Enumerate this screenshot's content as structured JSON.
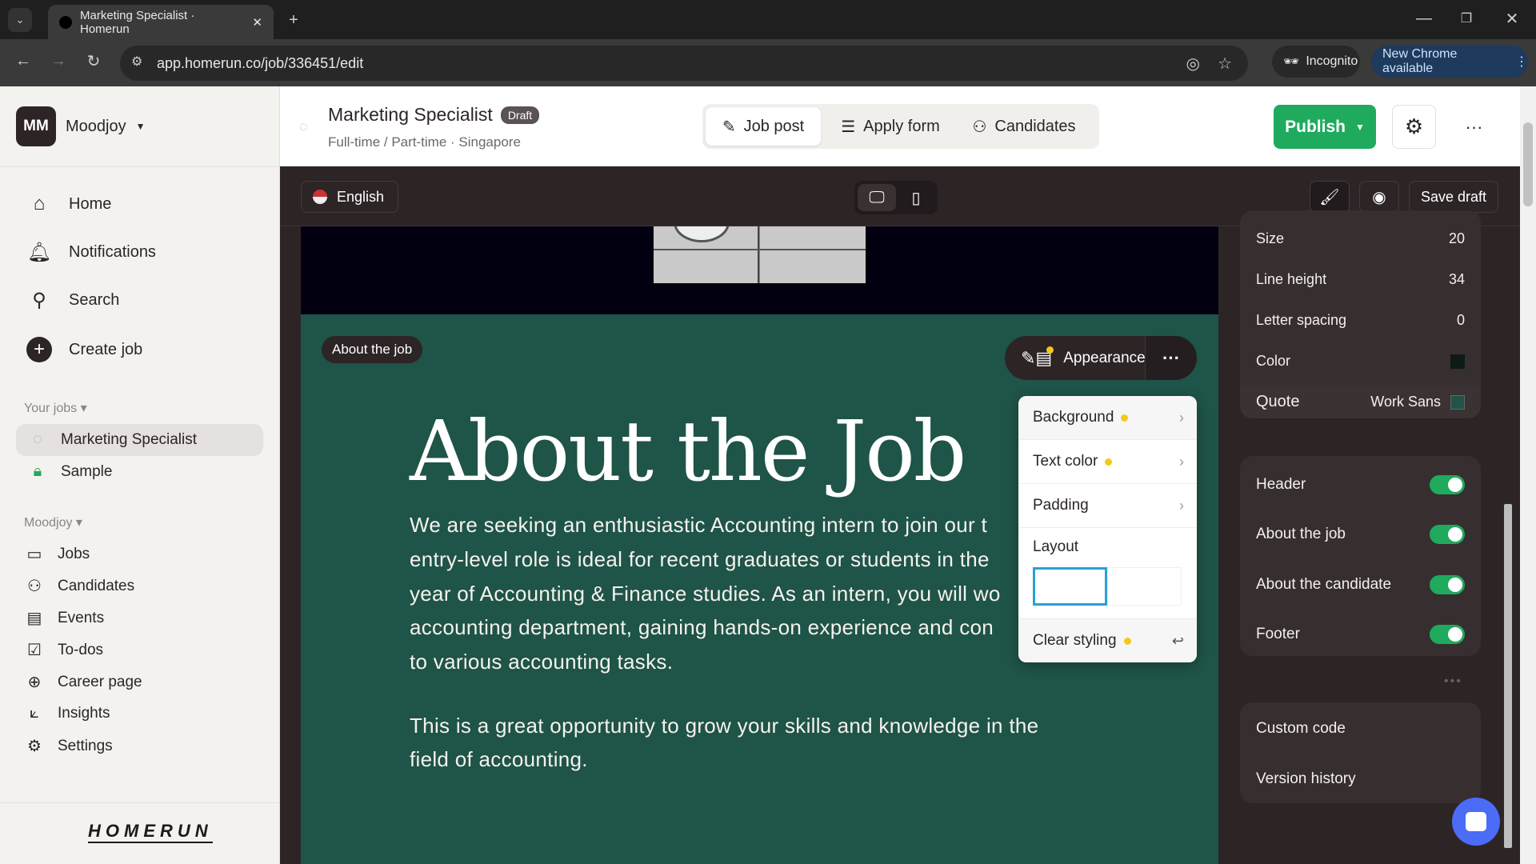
{
  "browser": {
    "tab_title": "Marketing Specialist · Homerun",
    "url": "app.homerun.co/job/336451/edit",
    "incognito": "Incognito",
    "update": "New Chrome available"
  },
  "sidebar": {
    "avatar": "MM",
    "org": "Moodjoy",
    "nav": [
      {
        "label": "Home",
        "icon": "home-icon"
      },
      {
        "label": "Notifications",
        "icon": "bell-icon"
      },
      {
        "label": "Search",
        "icon": "search-icon"
      },
      {
        "label": "Create job",
        "icon": "plus-circle-icon"
      }
    ],
    "your_jobs_label": "Your jobs",
    "jobs": [
      {
        "label": "Marketing Specialist",
        "active": true
      },
      {
        "label": "Sample"
      }
    ],
    "org_section": "Moodjoy",
    "org_items": [
      {
        "label": "Jobs",
        "icon": "jobs-icon"
      },
      {
        "label": "Candidates",
        "icon": "candidates-icon"
      },
      {
        "label": "Events",
        "icon": "calendar-icon"
      },
      {
        "label": "To-dos",
        "icon": "checkbox-icon"
      },
      {
        "label": "Career page",
        "icon": "globe-icon"
      },
      {
        "label": "Insights",
        "icon": "chart-icon"
      },
      {
        "label": "Settings",
        "icon": "gear-icon"
      }
    ],
    "logo": "HOMERUN"
  },
  "header": {
    "title": "Marketing Specialist",
    "badge": "Draft",
    "subtitle": "Full-time / Part-time · Singapore",
    "tabs": [
      {
        "label": "Job post",
        "active": true
      },
      {
        "label": "Apply form"
      },
      {
        "label": "Candidates"
      }
    ],
    "publish": "Publish"
  },
  "toolbar": {
    "language": "English",
    "save_draft": "Save draft"
  },
  "canvas": {
    "section_chip": "About the job",
    "appearance": "Appearance",
    "heading": "About the Job",
    "para1": [
      "We are seeking an enthusiastic Accounting intern to join our t",
      "entry-level role is ideal for recent graduates or students in the",
      "year of Accounting & Finance studies. As an intern, you will wo",
      "accounting department, gaining hands-on experience and con",
      "to various accounting tasks."
    ],
    "para2": [
      "This is a great opportunity to grow your skills and knowledge in the",
      "field of accounting."
    ],
    "bg_color": "#1f5448"
  },
  "menu": {
    "items": [
      {
        "label": "Background",
        "dot": true
      },
      {
        "label": "Text color",
        "dot": true
      },
      {
        "label": "Padding"
      }
    ],
    "layout": "Layout",
    "clear": "Clear styling"
  },
  "panel": {
    "typo": [
      {
        "label": "Size",
        "value": "20"
      },
      {
        "label": "Line height",
        "value": "34"
      },
      {
        "label": "Letter spacing",
        "value": "0"
      },
      {
        "label": "Color",
        "value": ""
      }
    ],
    "quote": {
      "label": "Quote",
      "font": "Work Sans"
    },
    "sections": [
      {
        "label": "Header",
        "on": true
      },
      {
        "label": "About the job",
        "on": true
      },
      {
        "label": "About the candidate",
        "on": true
      },
      {
        "label": "Footer",
        "on": true
      }
    ],
    "extra": [
      "Custom code",
      "Version history"
    ]
  }
}
